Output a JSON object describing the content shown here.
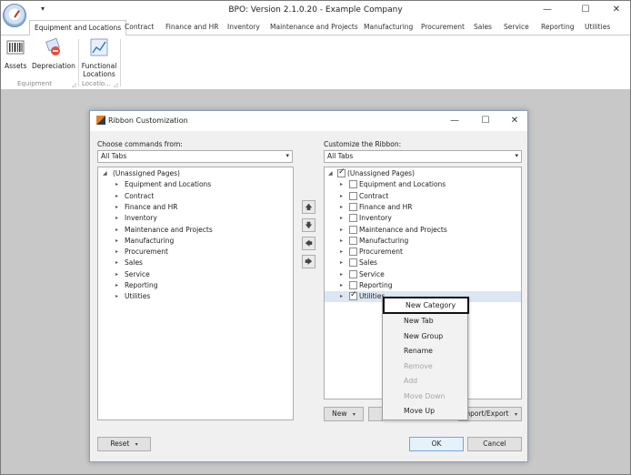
{
  "window": {
    "title": "BPO: Version 2.1.0.20 - Example Company",
    "qat_arrow": "▾",
    "minimize": "—",
    "maximize": "☐",
    "close": "✕"
  },
  "ribbon_tabs": [
    {
      "label": "Equipment and Locations",
      "active": true
    },
    {
      "label": "Contract"
    },
    {
      "label": "Finance and HR"
    },
    {
      "label": "Inventory"
    },
    {
      "label": "Maintenance and Projects"
    },
    {
      "label": "Manufacturing"
    },
    {
      "label": "Procurement"
    },
    {
      "label": "Sales"
    },
    {
      "label": "Service"
    },
    {
      "label": "Reporting"
    },
    {
      "label": "Utilities"
    }
  ],
  "ribbon": {
    "buttons": {
      "assets": "Assets",
      "depreciation": "Depreciation",
      "functional_locations_1": "Functional",
      "functional_locations_2": "Locations"
    },
    "groups": {
      "equipment": "Equipment",
      "locations": "Locatio..."
    },
    "launcher": "◿"
  },
  "dialog": {
    "title": "Ribbon Customization",
    "minimize": "—",
    "maximize": "☐",
    "close": "✕",
    "left": {
      "label": "Choose commands from:",
      "combo_value": "All Tabs",
      "tree": [
        {
          "label": "(Unassigned Pages)",
          "expanded": true,
          "level": 0
        },
        {
          "label": "Equipment and Locations",
          "level": 1
        },
        {
          "label": "Contract",
          "level": 1
        },
        {
          "label": "Finance and HR",
          "level": 1
        },
        {
          "label": "Inventory",
          "level": 1
        },
        {
          "label": "Maintenance and Projects",
          "level": 1
        },
        {
          "label": "Manufacturing",
          "level": 1
        },
        {
          "label": "Procurement",
          "level": 1
        },
        {
          "label": "Sales",
          "level": 1
        },
        {
          "label": "Service",
          "level": 1
        },
        {
          "label": "Reporting",
          "level": 1
        },
        {
          "label": "Utilities",
          "level": 1
        }
      ]
    },
    "right": {
      "label": "Customize the Ribbon:",
      "combo_value": "All Tabs",
      "tree": [
        {
          "label": "(Unassigned Pages)",
          "expanded": true,
          "level": 0,
          "checked": true
        },
        {
          "label": "Equipment and Locations",
          "level": 1,
          "checked": false
        },
        {
          "label": "Contract",
          "level": 1,
          "checked": false
        },
        {
          "label": "Finance and HR",
          "level": 1,
          "checked": false
        },
        {
          "label": "Inventory",
          "level": 1,
          "checked": false
        },
        {
          "label": "Maintenance and Projects",
          "level": 1,
          "checked": false
        },
        {
          "label": "Manufacturing",
          "level": 1,
          "checked": false
        },
        {
          "label": "Procurement",
          "level": 1,
          "checked": false
        },
        {
          "label": "Sales",
          "level": 1,
          "checked": false
        },
        {
          "label": "Service",
          "level": 1,
          "checked": false
        },
        {
          "label": "Reporting",
          "level": 1,
          "checked": false
        },
        {
          "label": "Utilities",
          "level": 1,
          "checked": true,
          "selected": true
        }
      ]
    },
    "move_buttons": {
      "up": "🡅",
      "down": "🡇",
      "left": "🡄",
      "right": "🡆"
    },
    "buttons": {
      "new": "New",
      "import_export": "Import/Export",
      "reset": "Reset",
      "ok": "OK",
      "cancel": "Cancel",
      "dropdown": "▾"
    }
  },
  "context_menu": [
    {
      "label": "New Category",
      "enabled": true,
      "highlighted": true
    },
    {
      "label": "New Tab",
      "enabled": true
    },
    {
      "label": "New Group",
      "enabled": true
    },
    {
      "label": "Rename",
      "enabled": true
    },
    {
      "label": "Remove",
      "enabled": false
    },
    {
      "label": "Add",
      "enabled": false
    },
    {
      "label": "Move Down",
      "enabled": false
    },
    {
      "label": "Move Up",
      "enabled": true
    }
  ],
  "icons": {
    "expanded": "◢",
    "collapsed": "▸",
    "combo_arrow": "▾"
  }
}
